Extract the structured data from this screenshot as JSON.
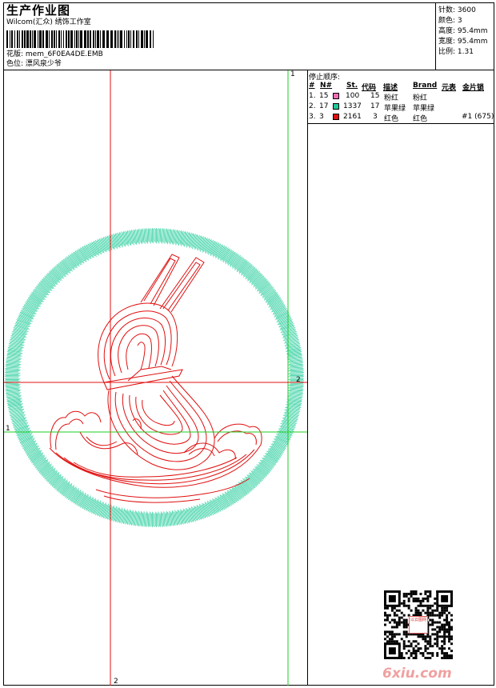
{
  "header": {
    "title": "生产作业图",
    "software": "Wilcom(汇众) 绣饰工作室",
    "design_label": "花版: mem_6F0EA4DE.EMB",
    "color_label": "色位: 漂风泉少爷"
  },
  "stats": {
    "stitches": "针数: 3600",
    "colors": "颜色: 3",
    "height": "高度: 95.4mm",
    "width": "宽度: 95.4mm",
    "ratio": "比例: 1.31"
  },
  "stop_sequence": {
    "title": "停止顺序:",
    "columns": [
      "#",
      "N#",
      "St.",
      "代码",
      "描述",
      "Brand",
      "元表",
      "金片锁"
    ],
    "rows": [
      {
        "index": "1.",
        "needle": "15",
        "color": "#ee6eb4",
        "stitches": "100",
        "code": "15",
        "desc": "粉红",
        "brand": "粉红",
        "extra": ""
      },
      {
        "index": "2.",
        "needle": "17",
        "color": "#1fc99a",
        "stitches": "1337",
        "code": "17",
        "desc": "苹果绿",
        "brand": "苹果绿",
        "extra": ""
      },
      {
        "index": "3.",
        "needle": "3",
        "color": "#e01010",
        "stitches": "2161",
        "code": "3",
        "desc": "红色",
        "brand": "红色",
        "extra": "#1 (675)"
      }
    ]
  },
  "guides": {
    "red_vertical_label": "2",
    "green_vertical_label": "1",
    "red_horizontal_label": "2",
    "green_horizontal_label": "1"
  },
  "colors": {
    "ring": "#2fcf9f",
    "design": "#e01010",
    "guide_red": "#e01010",
    "guide_green": "#22cc22"
  },
  "watermark": {
    "logo": "6xiu.com",
    "stamp": "以云图网"
  }
}
